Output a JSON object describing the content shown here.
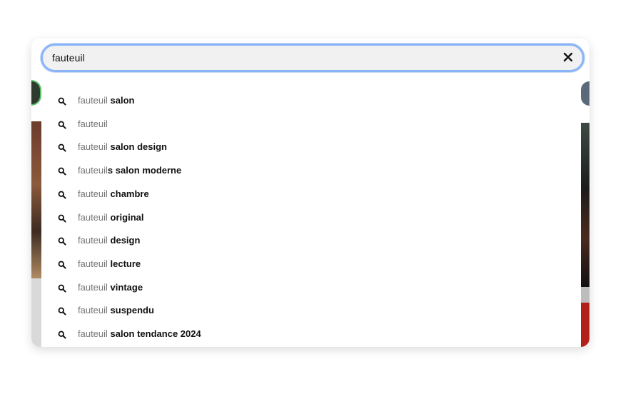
{
  "search": {
    "value": "fauteuil",
    "clear_icon": "close-icon"
  },
  "suggestions": [
    {
      "typed": "fauteuil",
      "rest": " salon",
      "icon": "search-icon"
    },
    {
      "typed": "fauteuil",
      "rest": "",
      "icon": "search-icon"
    },
    {
      "typed": "fauteuil",
      "rest": " salon design",
      "icon": "search-icon"
    },
    {
      "typed": "fauteuil",
      "rest": "s salon moderne",
      "icon": "search-icon"
    },
    {
      "typed": "fauteuil",
      "rest": " chambre",
      "icon": "search-icon"
    },
    {
      "typed": "fauteuil",
      "rest": " original",
      "icon": "search-icon"
    },
    {
      "typed": "fauteuil",
      "rest": " design",
      "icon": "search-icon"
    },
    {
      "typed": "fauteuil",
      "rest": " lecture",
      "icon": "search-icon"
    },
    {
      "typed": "fauteuil",
      "rest": " vintage",
      "icon": "search-icon"
    },
    {
      "typed": "fauteuil",
      "rest": " suspendu",
      "icon": "search-icon"
    },
    {
      "typed": "fauteuil",
      "rest": " salon tendance 2024",
      "icon": "search-icon"
    }
  ],
  "colors": {
    "focus_ring": "#8ab4f8",
    "input_bg": "#f1f1f1",
    "typed_text": "#767676",
    "completion_text": "#111111"
  }
}
